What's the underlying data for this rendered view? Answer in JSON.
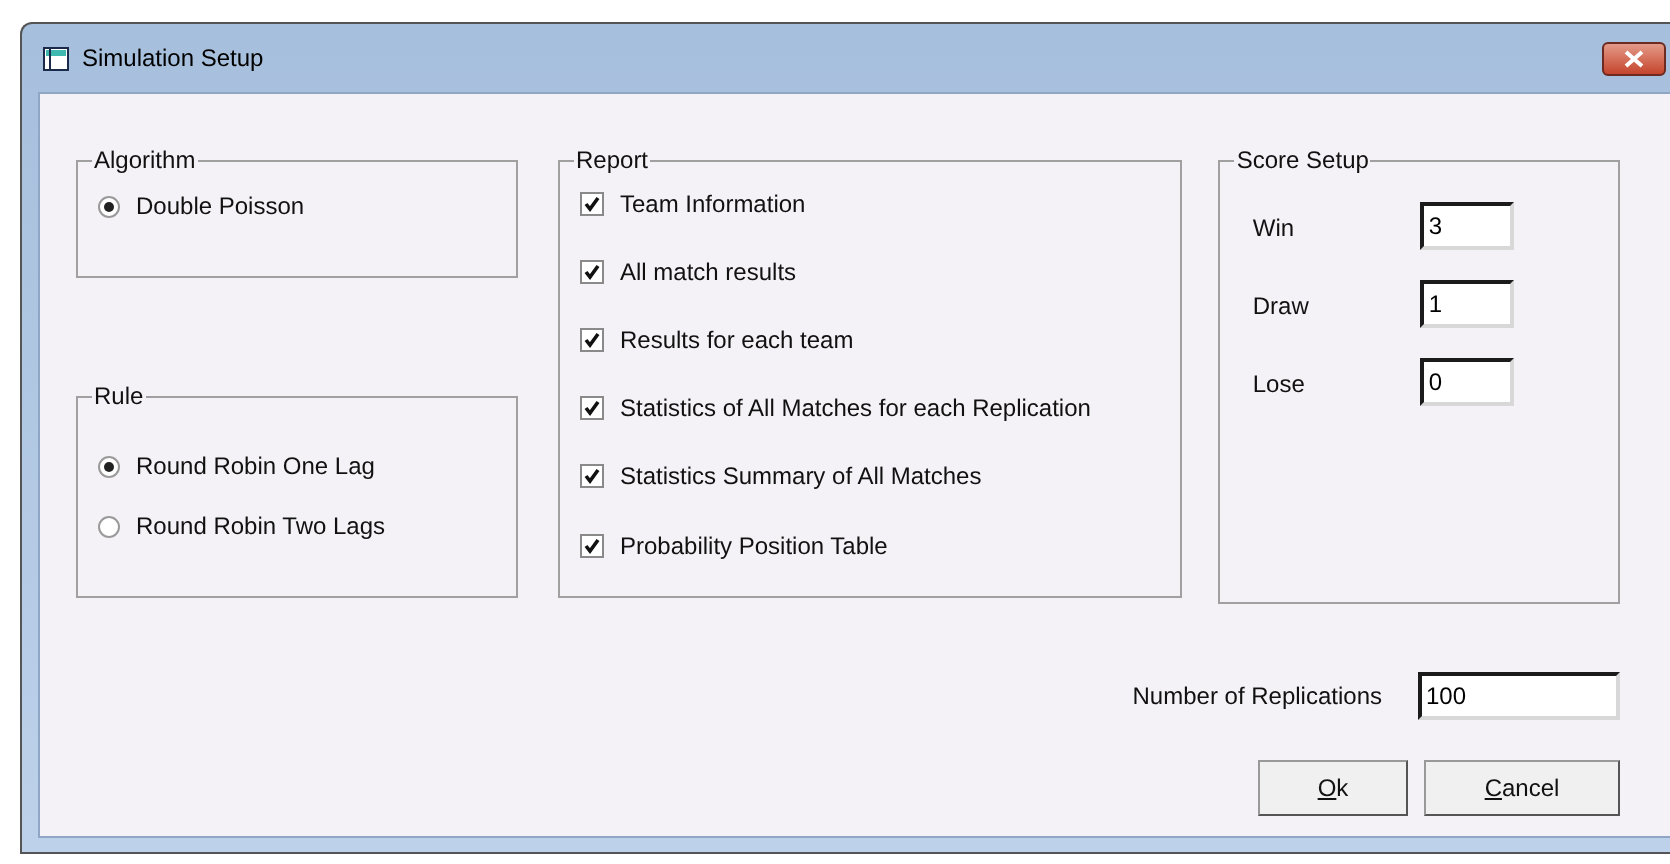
{
  "window": {
    "title": "Simulation Setup"
  },
  "algorithm": {
    "legend": "Algorithm",
    "options": [
      {
        "label": "Double Poisson",
        "selected": true
      }
    ]
  },
  "rule": {
    "legend": "Rule",
    "options": [
      {
        "label": "Round Robin One Lag",
        "selected": true
      },
      {
        "label": "Round Robin Two Lags",
        "selected": false
      }
    ]
  },
  "report": {
    "legend": "Report",
    "items": [
      {
        "label": "Team Information",
        "checked": true
      },
      {
        "label": "All match results",
        "checked": true
      },
      {
        "label": "Results for each team",
        "checked": true
      },
      {
        "label": "Statistics of All Matches for each Replication",
        "checked": true
      },
      {
        "label": "Statistics Summary of All Matches",
        "checked": true
      },
      {
        "label": "Probability Position Table",
        "checked": true
      }
    ]
  },
  "score_setup": {
    "legend": "Score Setup",
    "fields": [
      {
        "label": "Win",
        "value": "3"
      },
      {
        "label": "Draw",
        "value": "1"
      },
      {
        "label": "Lose",
        "value": "0"
      }
    ]
  },
  "replications": {
    "label": "Number of Replications",
    "value": "100"
  },
  "buttons": [
    "Ok",
    "Cancel"
  ]
}
